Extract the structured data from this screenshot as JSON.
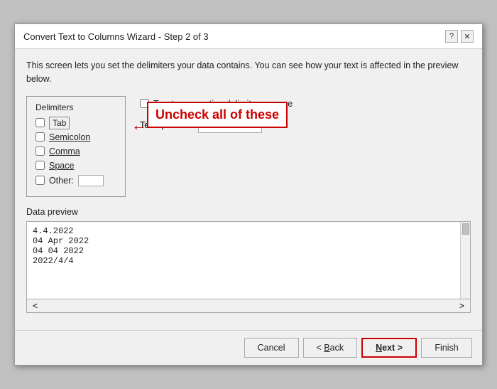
{
  "dialog": {
    "title": "Convert Text to Columns Wizard - Step 2 of 3",
    "help_icon": "?",
    "close_icon": "✕"
  },
  "description": "This screen lets you set the delimiters your data contains.  You can see how your text is affected in the preview below.",
  "annotation": {
    "text": "Uncheck all of these",
    "arrow": "←"
  },
  "delimiters": {
    "label": "Delimiters",
    "items": [
      {
        "id": "tab",
        "label": "Tab",
        "checked": false,
        "underline": true,
        "is_tab": true
      },
      {
        "id": "semicolon",
        "label": "Semicolon",
        "checked": false,
        "underline": true
      },
      {
        "id": "comma",
        "label": "Comma",
        "checked": false,
        "underline": true
      },
      {
        "id": "space",
        "label": "Space",
        "checked": false,
        "underline": true
      },
      {
        "id": "other",
        "label": "Other:",
        "checked": false,
        "underline": false,
        "has_input": true
      }
    ]
  },
  "options": {
    "consecutive_label": "Treat consecutive delimiters as one",
    "consecutive_checked": false,
    "qualifier_label": "Text qualifier:",
    "qualifier_value": "\""
  },
  "preview": {
    "label": "Data preview",
    "lines": [
      "4.4.2022",
      "04 Apr 2022",
      "04 04 2022",
      "2022/4/4"
    ]
  },
  "footer": {
    "cancel_label": "Cancel",
    "back_label": "< Back",
    "next_label": "Next >",
    "finish_label": "Finish"
  }
}
